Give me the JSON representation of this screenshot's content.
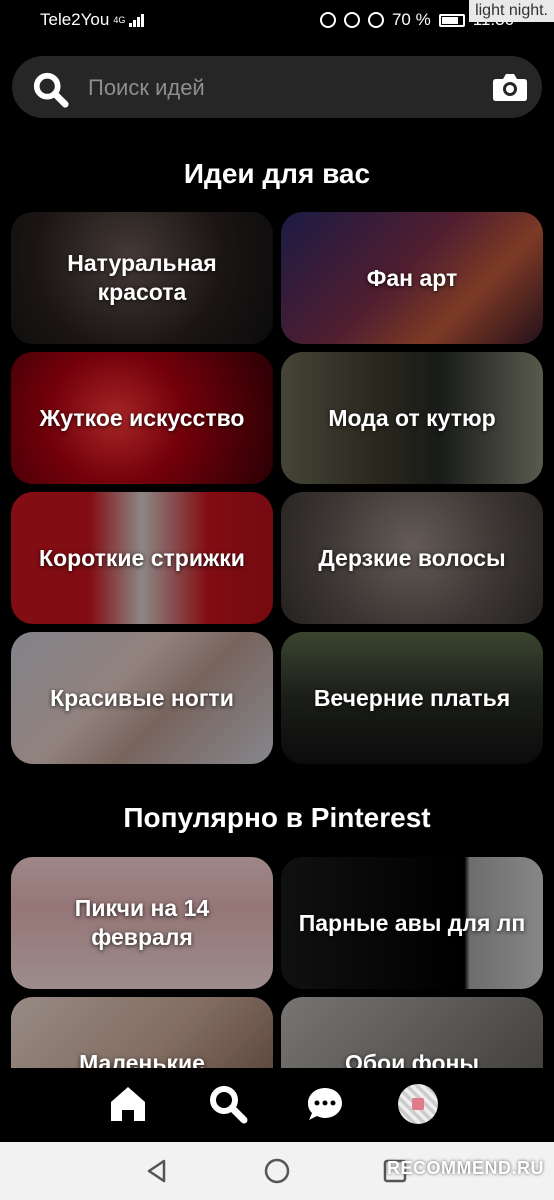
{
  "status_bar": {
    "carrier": "Tele2You",
    "network": "4G",
    "battery_percent": "70 %",
    "time": "11:36",
    "watermark": "light night."
  },
  "search": {
    "placeholder": "Поиск идей",
    "search_icon": "search-icon",
    "camera_icon": "camera-icon"
  },
  "ideas_section": {
    "title": "Идеи для вас",
    "tiles": [
      {
        "label": "Натуральная красота"
      },
      {
        "label": "Фан арт"
      },
      {
        "label": "Жуткое искусство"
      },
      {
        "label": "Мода от кутюр"
      },
      {
        "label": "Короткие стрижки"
      },
      {
        "label": "Дерзкие волосы"
      },
      {
        "label": "Красивые ногти"
      },
      {
        "label": "Вечерние платья"
      }
    ]
  },
  "popular_section": {
    "title": "Популярно в Pinterest",
    "tiles": [
      {
        "label": "Пикчи на 14 февраля"
      },
      {
        "label": "Парные авы для лп"
      },
      {
        "label": "Маленькие"
      },
      {
        "label": "Обои фоны"
      }
    ]
  },
  "bottom_nav": {
    "items": [
      {
        "icon": "home-icon"
      },
      {
        "icon": "search-icon",
        "active": true
      },
      {
        "icon": "messages-icon"
      },
      {
        "icon": "profile-avatar"
      }
    ]
  },
  "system_nav": {
    "watermark": "RECOMMEND.RU"
  }
}
